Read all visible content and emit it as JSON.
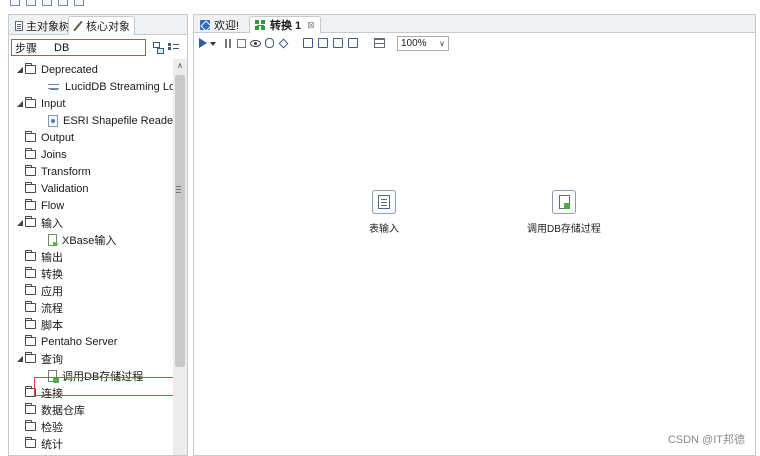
{
  "left_panel": {
    "tabs": [
      {
        "label": "主对象树"
      },
      {
        "label": "核心对象"
      }
    ],
    "search": {
      "label": "步骤",
      "value": "DB"
    },
    "tree": [
      {
        "label": "Deprecated"
      },
      {
        "label": "LucidDB Streaming Lo"
      },
      {
        "label": "Input"
      },
      {
        "label": "ESRI Shapefile Reader"
      },
      {
        "label": "Output"
      },
      {
        "label": "Joins"
      },
      {
        "label": "Transform"
      },
      {
        "label": "Validation"
      },
      {
        "label": "Flow"
      },
      {
        "label": "输入"
      },
      {
        "label": "XBase输入"
      },
      {
        "label": "输出"
      },
      {
        "label": "转换"
      },
      {
        "label": "应用"
      },
      {
        "label": "流程"
      },
      {
        "label": "脚本"
      },
      {
        "label": "Pentaho Server"
      },
      {
        "label": "查询"
      },
      {
        "label": "调用DB存储过程"
      },
      {
        "label": "连接"
      },
      {
        "label": "数据仓库"
      },
      {
        "label": "检验"
      },
      {
        "label": "统计"
      }
    ]
  },
  "editor": {
    "tabs": [
      {
        "label": "欢迎!"
      },
      {
        "label": "转换 1",
        "close": "⊠"
      }
    ],
    "zoom": "100%",
    "nodes": [
      {
        "label": "表输入"
      },
      {
        "label": "调用DB存储过程"
      }
    ]
  },
  "watermark": "CSDN @IT邦德",
  "icons": {
    "expanded": "◢",
    "collapsed": "▷",
    "scroll_up": "∧",
    "dropdown": "∨"
  },
  "colors": {
    "highlight_border": "#e0424a",
    "accent_blue": "#2e5ca8",
    "transform_green": "#2e9c3e"
  }
}
